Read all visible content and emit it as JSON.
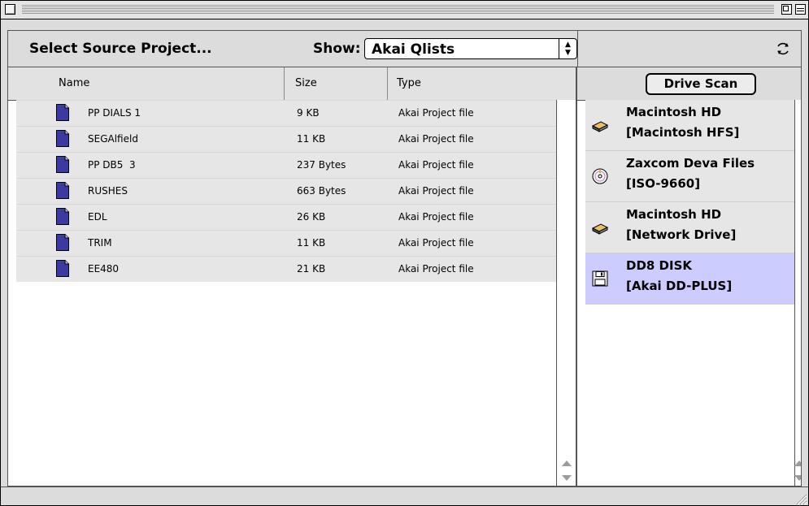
{
  "header": {
    "title": "Select Source Project...",
    "show_label": "Show:",
    "show_value": "Akai Qlists"
  },
  "columns": {
    "name": "Name",
    "size": "Size",
    "type": "Type"
  },
  "files": [
    {
      "name": "PP DIALS 1",
      "size": "9 KB",
      "type": "Akai Project file"
    },
    {
      "name": "SEGAlfield",
      "size": "11 KB",
      "type": "Akai Project file"
    },
    {
      "name": "PP DB5  3",
      "size": "237 Bytes",
      "type": "Akai Project file"
    },
    {
      "name": "RUSHES",
      "size": "663 Bytes",
      "type": "Akai Project file"
    },
    {
      "name": "EDL",
      "size": "26 KB",
      "type": "Akai Project file"
    },
    {
      "name": "TRIM",
      "size": "11 KB",
      "type": "Akai Project file"
    },
    {
      "name": "EE480",
      "size": "21 KB",
      "type": "Akai Project file"
    }
  ],
  "drive_scan_label": "Drive Scan",
  "drives": [
    {
      "name": "Macintosh HD",
      "format": "[Macintosh HFS]",
      "icon": "hard-disk-icon",
      "selected": false
    },
    {
      "name": "Zaxcom Deva Files",
      "format": "[ISO-9660]",
      "icon": "cd-disc-icon",
      "selected": false
    },
    {
      "name": "Macintosh HD",
      "format": "[Network Drive]",
      "icon": "hard-disk-icon",
      "selected": false
    },
    {
      "name": "DD8 DISK",
      "format": "[Akai DD-PLUS]",
      "icon": "floppy-disk-icon",
      "selected": true
    }
  ],
  "colors": {
    "selection": "#ccccff",
    "row_bg": "#e6e6e6",
    "chrome": "#dcdcdc"
  }
}
